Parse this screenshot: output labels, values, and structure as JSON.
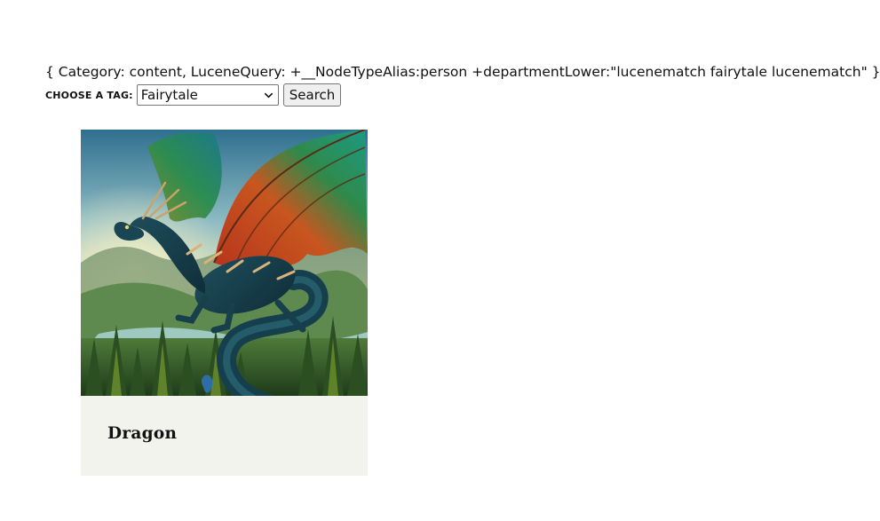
{
  "query": {
    "text": "{ Category: content, LuceneQuery: +__NodeTypeAlias:person +departmentLower:\"lucenematch fairytale lucenematch\" }"
  },
  "filter": {
    "label": "CHOOSE A TAG:",
    "selected_value": "Fairytale",
    "search_label": "Search"
  },
  "results": [
    {
      "title": "Dragon",
      "image": "dragon-illustration"
    }
  ],
  "colors": {
    "card_background": "#f3f3ee",
    "button_background": "#efefef",
    "text": "#111111"
  }
}
